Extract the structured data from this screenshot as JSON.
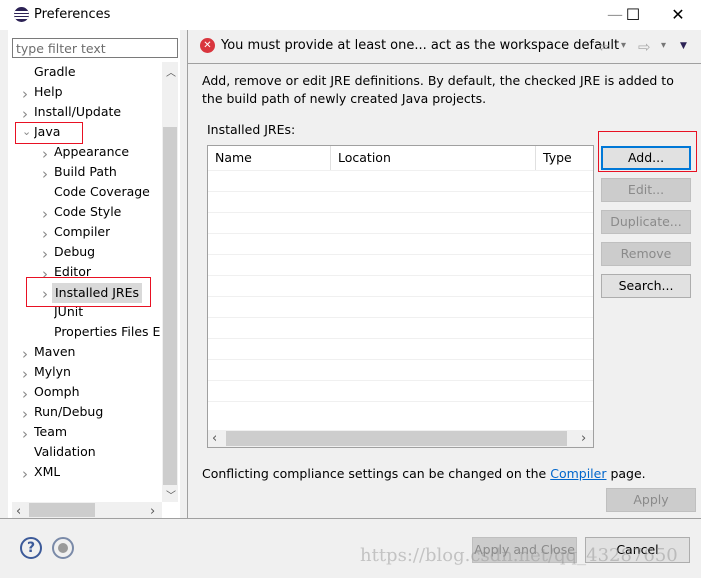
{
  "window": {
    "title": "Preferences",
    "icon": "eclipse-icon",
    "controls": {
      "minimize": "—",
      "maximize": "☐",
      "close": "✕"
    }
  },
  "sidebar": {
    "filter_placeholder": "type filter text",
    "items": [
      {
        "label": "Gradle",
        "level": 0,
        "chevron": ""
      },
      {
        "label": "Help",
        "level": 0,
        "chevron": "›"
      },
      {
        "label": "Install/Update",
        "level": 0,
        "chevron": "›"
      },
      {
        "label": "Java",
        "level": 0,
        "chevron": "⌄",
        "expanded": true
      },
      {
        "label": "Appearance",
        "level": 1,
        "chevron": "›"
      },
      {
        "label": "Build Path",
        "level": 1,
        "chevron": "›"
      },
      {
        "label": "Code Coverage",
        "level": 1,
        "chevron": ""
      },
      {
        "label": "Code Style",
        "level": 1,
        "chevron": "›"
      },
      {
        "label": "Compiler",
        "level": 1,
        "chevron": "›"
      },
      {
        "label": "Debug",
        "level": 1,
        "chevron": "›"
      },
      {
        "label": "Editor",
        "level": 1,
        "chevron": "›"
      },
      {
        "label": "Installed JREs",
        "level": 1,
        "chevron": "›",
        "selected": true
      },
      {
        "label": "JUnit",
        "level": 1,
        "chevron": ""
      },
      {
        "label": "Properties Files Ed",
        "level": 1,
        "chevron": ""
      },
      {
        "label": "Maven",
        "level": 0,
        "chevron": "›"
      },
      {
        "label": "Mylyn",
        "level": 0,
        "chevron": "›"
      },
      {
        "label": "Oomph",
        "level": 0,
        "chevron": "›"
      },
      {
        "label": "Run/Debug",
        "level": 0,
        "chevron": "›"
      },
      {
        "label": "Team",
        "level": 0,
        "chevron": "›"
      },
      {
        "label": "Validation",
        "level": 0,
        "chevron": ""
      },
      {
        "label": "XML",
        "level": 0,
        "chevron": "›"
      }
    ]
  },
  "header": {
    "error_message": "You must provide at least one... act as the workspace default",
    "error_icon": "error-icon",
    "nav": {
      "back": "⇦",
      "forward": "⇨",
      "dropdown": "▾",
      "menu": "▼"
    }
  },
  "main": {
    "description": "Add, remove or edit JRE definitions. By default, the checked JRE is added to the build path of newly created Java projects.",
    "installed_label": "Installed JREs:",
    "columns": [
      "Name",
      "Location",
      "Type"
    ],
    "rows": [],
    "buttons": [
      {
        "label": "Add...",
        "enabled": true,
        "focused": true
      },
      {
        "label": "Edit...",
        "enabled": false
      },
      {
        "label": "Duplicate...",
        "enabled": false
      },
      {
        "label": "Remove",
        "enabled": false
      },
      {
        "label": "Search...",
        "enabled": true
      }
    ],
    "compliance_prefix": "Conflicting compliance settings can be changed on the ",
    "compliance_link": "Compiler",
    "compliance_suffix": " page.",
    "apply": "Apply"
  },
  "footer": {
    "apply_close": "Apply and Close",
    "cancel": "Cancel",
    "help_icon": "help-icon",
    "record_icon": "record-icon"
  },
  "watermark": "https://blog.csdn.net/qq_43287650",
  "colors": {
    "highlight": "#e81123",
    "focus": "#0078d7",
    "link": "#0066cc",
    "error": "#d9363e"
  }
}
